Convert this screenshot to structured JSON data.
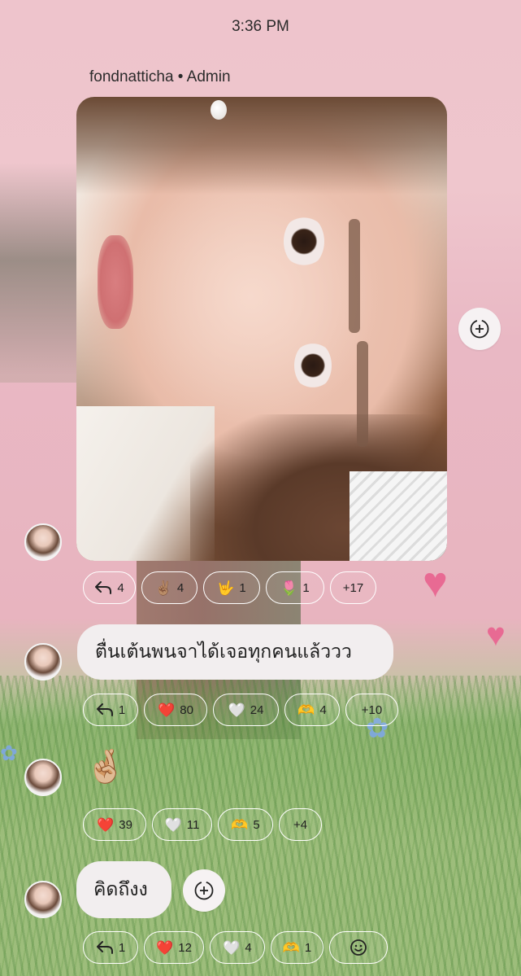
{
  "status_bar": {
    "time": "3:36 PM"
  },
  "post": {
    "sender_line": "fondnatticha • Admin",
    "photo_reactions": [
      {
        "icon": "reply-icon",
        "emoji": "",
        "count": "4"
      },
      {
        "icon": "victory-hand-icon",
        "emoji": "✌🏽",
        "count": "4"
      },
      {
        "icon": "rock-on-hand-icon",
        "emoji": "🤟",
        "count": "1"
      },
      {
        "icon": "tulip-icon",
        "emoji": "🌷",
        "count": "1"
      },
      {
        "icon": "",
        "emoji": "",
        "count": "+17"
      }
    ]
  },
  "messages": [
    {
      "text": "ตื่นเต้นพนจาได้เจอทุกคนแล้ววว",
      "reactions": [
        {
          "icon": "reply-icon",
          "emoji": "",
          "count": "1"
        },
        {
          "icon": "red-heart-icon",
          "emoji": "❤️",
          "count": "80"
        },
        {
          "icon": "white-heart-icon",
          "emoji": "🤍",
          "count": "24"
        },
        {
          "icon": "heart-hands-icon",
          "emoji": "🫶",
          "count": "4"
        },
        {
          "icon": "",
          "emoji": "",
          "count": "+10"
        }
      ]
    },
    {
      "emoji_message": "🤞🏼",
      "reactions": [
        {
          "icon": "red-heart-icon",
          "emoji": "❤️",
          "count": "39"
        },
        {
          "icon": "white-heart-icon",
          "emoji": "🤍",
          "count": "11"
        },
        {
          "icon": "heart-hands-icon",
          "emoji": "🫶",
          "count": "5"
        },
        {
          "icon": "",
          "emoji": "",
          "count": "+4"
        }
      ]
    },
    {
      "text": "คิดถึงง",
      "reactions": [
        {
          "icon": "reply-icon",
          "emoji": "",
          "count": "1"
        },
        {
          "icon": "red-heart-icon",
          "emoji": "❤️",
          "count": "12"
        },
        {
          "icon": "white-heart-icon",
          "emoji": "🤍",
          "count": "4"
        },
        {
          "icon": "heart-hands-icon",
          "emoji": "🫶",
          "count": "1"
        },
        {
          "icon": "add-reaction-icon",
          "emoji": "",
          "count": ""
        }
      ]
    }
  ]
}
